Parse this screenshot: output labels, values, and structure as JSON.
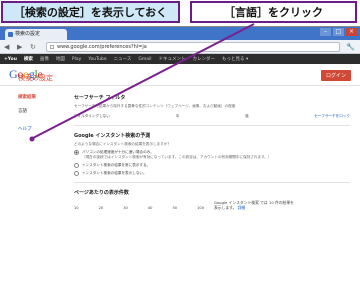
{
  "captions": {
    "left": "［検索の設定］を表示しておく",
    "right": "［言語］をクリック"
  },
  "browser": {
    "tab_title": "検索の設定",
    "url": "www.google.com/preferences?hl=ja",
    "back": "◀",
    "forward": "▶",
    "reload": "↻",
    "wrench": "🔧",
    "win_min": "–",
    "win_max": "□",
    "win_close": "×"
  },
  "gbar": {
    "items": [
      "+You",
      "検索",
      "画像",
      "地図",
      "Play",
      "YouTube",
      "ニュース",
      "Gmail",
      "ドキュメント",
      "カレンダー",
      "もっと見る ▾"
    ]
  },
  "header": {
    "logo": [
      "G",
      "o",
      "o",
      "g",
      "l",
      "e"
    ],
    "login": "ログイン"
  },
  "page": {
    "title": "検索の設定"
  },
  "sidebar": {
    "items": [
      "検索結果",
      "言語"
    ],
    "help": "ヘルプ"
  },
  "safesearch": {
    "title": "セーフサーチ フィルタ",
    "desc": "セーフサーチで結果から除外する露骨な性的コンテンツ（ウェブページ、画像、および動画）の程度",
    "link": "セーフサーチをロック",
    "left": "フィルタリングしない",
    "mid": "中",
    "right": "強"
  },
  "instant": {
    "title": "Google インスタント検索の予測",
    "q": "どのような場合にインスタント検索の結果を表示しますか？",
    "opt1": "パソコンの処理速度が十分に速い場合のみ。",
    "opt1_note": "（現在の接続ではインスタント検索が有効になっています。この設定は、アカウントの有効期間中に保持されます。）",
    "opt2": "インスタント検索の結果を常に表示する。",
    "opt3": "インスタント検索の結果を表示しない。"
  },
  "perpage": {
    "title": "ページあたりの表示件数",
    "ticks": [
      "10",
      "20",
      "30",
      "40",
      "50",
      "100"
    ],
    "note": "Google インスタント検索 では 10 件の結果を表示します。",
    "link": "詳細"
  }
}
